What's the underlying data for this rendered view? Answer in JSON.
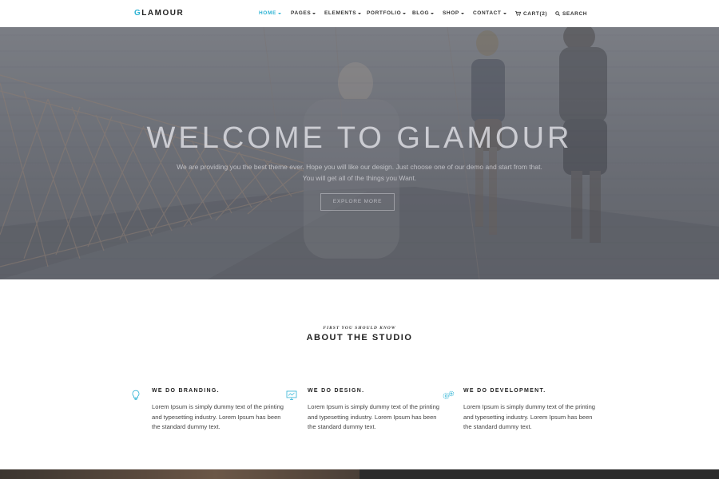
{
  "brand": {
    "logo_accent": "G",
    "logo_rest": "LAMOUR",
    "accent_color": "#2eb3d4"
  },
  "nav": {
    "items": [
      {
        "label": "HOME",
        "active": true
      },
      {
        "label": "PAGES",
        "active": false
      },
      {
        "label": "ELEMENTS",
        "active": false
      },
      {
        "label": "PORTFOLIO",
        "active": false
      },
      {
        "label": "BLOG",
        "active": false
      },
      {
        "label": "SHOP",
        "active": false
      },
      {
        "label": "CONTACT",
        "active": false
      }
    ],
    "cart_label": "CART(2)",
    "search_label": "SEARCH",
    "icons": {
      "cart": "cart-icon",
      "search": "search-icon",
      "dropdown": "chevron-down-icon"
    }
  },
  "hero": {
    "title": "WELCOME TO GLAMOUR",
    "subtitle_line1": "We are providing you the best theme ever. Hope you will like our design. Just choose one of our demo and start from that.",
    "subtitle_line2": "You will get all of the things you Want.",
    "button_label": "EXPLORE MORE"
  },
  "about": {
    "eyebrow": "FIRST YOU SHOULD KNOW",
    "title": "ABOUT THE STUDIO",
    "features": [
      {
        "icon": "lightbulb-icon",
        "title": "WE DO BRANDING.",
        "text": "Lorem Ipsum is simply dummy text of the printing and typesetting industry. Lorem Ipsum has been the standard dummy text."
      },
      {
        "icon": "monitor-icon",
        "title": "WE DO DESIGN.",
        "text": "Lorem Ipsum is simply dummy text of the printing and typesetting industry. Lorem Ipsum has been the standard dummy text."
      },
      {
        "icon": "gears-icon",
        "title": "WE DO DEVELOPMENT.",
        "text": "Lorem Ipsum is simply dummy text of the printing and typesetting industry. Lorem Ipsum has been the standard dummy text."
      }
    ]
  }
}
